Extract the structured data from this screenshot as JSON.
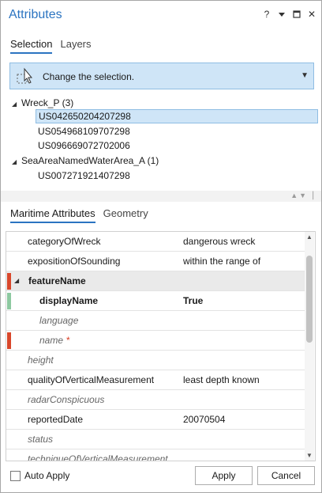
{
  "window": {
    "title": "Attributes",
    "controls": [
      "help-icon",
      "pin-dropdown-icon",
      "maximize-icon",
      "close-icon"
    ],
    "help_glyph": "?",
    "close_glyph": "✕"
  },
  "top_tabs": [
    {
      "label": "Selection",
      "active": true
    },
    {
      "label": "Layers",
      "active": false
    }
  ],
  "selection_dropdown": {
    "label": "Change the selection.",
    "icon": "select-cursor-icon"
  },
  "tree": {
    "layers": [
      {
        "label": "Wreck_P (3)",
        "features": [
          "US042650204207298",
          "US054968109707298",
          "US096669072702006"
        ]
      },
      {
        "label": "SeaAreaNamedWaterArea_A (1)",
        "features": [
          "US007271921407298"
        ]
      }
    ],
    "selected_feature": "US042650204207298"
  },
  "bottom_tabs": [
    {
      "label": "Maritime Attributes",
      "active": true
    },
    {
      "label": "Geometry",
      "active": false
    }
  ],
  "attributes": [
    {
      "name": "categoryOfWreck",
      "value": "dangerous wreck",
      "style": "normal"
    },
    {
      "name": "expositionOfSounding",
      "value": "within the range of",
      "style": "normal"
    },
    {
      "name": "featureName",
      "value": "",
      "style": "group",
      "marker": "#d9472b"
    },
    {
      "name": "displayName",
      "value": "True",
      "style": "child-bold",
      "marker": "#8dc9a0"
    },
    {
      "name": "language",
      "value": "",
      "style": "child-empty"
    },
    {
      "name": "name",
      "value": "",
      "style": "child-empty",
      "marker": "#d9472b",
      "required_mark": "*"
    },
    {
      "name": "height",
      "value": "",
      "style": "empty"
    },
    {
      "name": "qualityOfVerticalMeasurement",
      "value": "least depth known",
      "style": "normal"
    },
    {
      "name": "radarConspicuous",
      "value": "",
      "style": "empty"
    },
    {
      "name": "reportedDate",
      "value": "20070504",
      "style": "normal"
    },
    {
      "name": "status",
      "value": "",
      "style": "empty"
    },
    {
      "name": "techniqueOfVerticalMeasurement",
      "value": "",
      "style": "empty"
    }
  ],
  "footer": {
    "auto_apply_label": "Auto Apply",
    "auto_apply_checked": false,
    "apply_label": "Apply",
    "cancel_label": "Cancel"
  },
  "colors": {
    "accent": "#2b74c1",
    "selection_fill": "#cfe5f7",
    "required_marker": "#d9472b",
    "edited_marker": "#8dc9a0"
  }
}
